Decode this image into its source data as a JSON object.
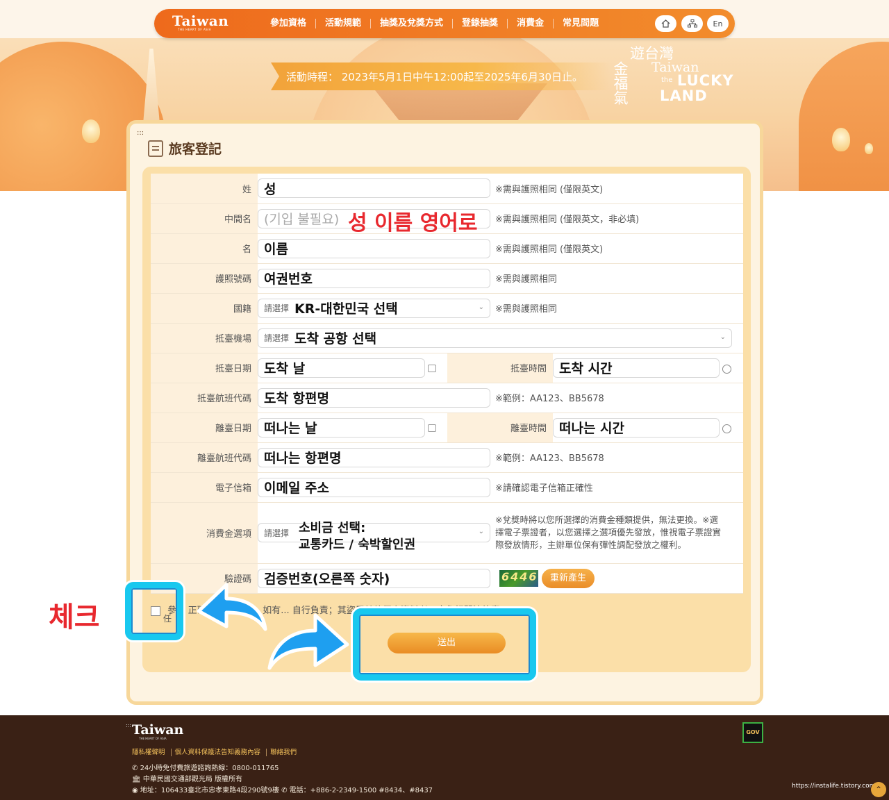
{
  "nav": {
    "logo": "Taiwan",
    "logo_sub": "THE HEART OF ASIA",
    "menu": [
      "參加資格",
      "活動規範",
      "抽獎及兌獎方式",
      "登錄抽獎",
      "消費金",
      "常見問題"
    ],
    "lang": "En"
  },
  "banner": {
    "period": "活動時程： 2023年5月1日中午12:00起至2025年6月30日止。",
    "lucky_cn_1": "遊台灣",
    "lucky_cn_2": "金福氣",
    "lucky_en_1": "Taiwan",
    "lucky_en_small": "the",
    "lucky_en_2": "LUCKY",
    "lucky_en_3": "LAND"
  },
  "form": {
    "title": "旅客登記",
    "rows": {
      "surname": {
        "label": "姓",
        "value": "성",
        "note": "※需與護照相同 (僅限英文)"
      },
      "middle": {
        "label": "中間名",
        "placeholder": "(기입 불필요)",
        "note": "※需與護照相同 (僅限英文，非必填)"
      },
      "given": {
        "label": "名",
        "value": "이름",
        "note": "※需與護照相同 (僅限英文)"
      },
      "passport": {
        "label": "護照號碼",
        "value": "여권번호",
        "note": "※需與護照相同"
      },
      "nationality": {
        "label": "國籍",
        "pre": "請選擇",
        "value": "KR-대한민국 선택",
        "note": "※需與護照相同"
      },
      "airport": {
        "label": "抵臺機場",
        "pre": "請選擇",
        "value": "도착 공항 선택"
      },
      "arrival": {
        "label": "抵臺日期",
        "value": "도착 날",
        "time_label": "抵臺時間",
        "time_value": "도착 시간"
      },
      "arrival_flight": {
        "label": "抵臺航班代碼",
        "value": "도착 항편명",
        "note": "※範例：AA123、BB5678"
      },
      "departure": {
        "label": "離臺日期",
        "value": "떠나는 날",
        "time_label": "離臺時間",
        "time_value": "떠나는 시간"
      },
      "departure_flight": {
        "label": "離臺航班代碼",
        "value": "떠나는 항편명",
        "note": "※範例：AA123、BB5678"
      },
      "email": {
        "label": "電子信箱",
        "value": "이메일 주소",
        "note": "※請確認電子信箱正確性"
      },
      "voucher": {
        "label": "消費金選項",
        "pre": "請選擇",
        "value_line1": "소비금 선택:",
        "value_line2": "교통카드 / 숙박할인권",
        "note": "※兌獎時將以您所選擇的消費金種類提供，無法更換。※選擇電子票證者，以您選擇之選項優先發放，惟視電子票證實際發放情形，主辦單位保有彈性調配發放之權利。"
      },
      "captcha": {
        "label": "驗證碼",
        "value": "검증번호(오른쪽 숫자)",
        "code": "6446",
        "regen": "重新產生"
      }
    },
    "agree_text": "參... 正確性及... 實性，如有... 自行負責；其盜用其他個人資料者，應負相關法律責",
    "agree_text_2": "任",
    "submit": "送出"
  },
  "annotations": {
    "name_hint": "성 이름 영어로",
    "check": "체크"
  },
  "footer": {
    "logo": "Taiwan",
    "logo_sub": "THE HEART OF ASIA",
    "links": [
      "隱私權聲明",
      "個人資料保護法告知義務內容",
      "聯絡我們"
    ],
    "hotline": "24小時免付費旅遊諮詢熱線：0800-011765",
    "copyright": "中華民國交通部觀光局 版權所有",
    "address": "地址：106433臺北市忠孝東路4段290號9樓",
    "phone": "電話：+886-2-2349-1500 #8434、#8437",
    "gov": "GOV",
    "url": "https://instalife.tistory.com"
  }
}
